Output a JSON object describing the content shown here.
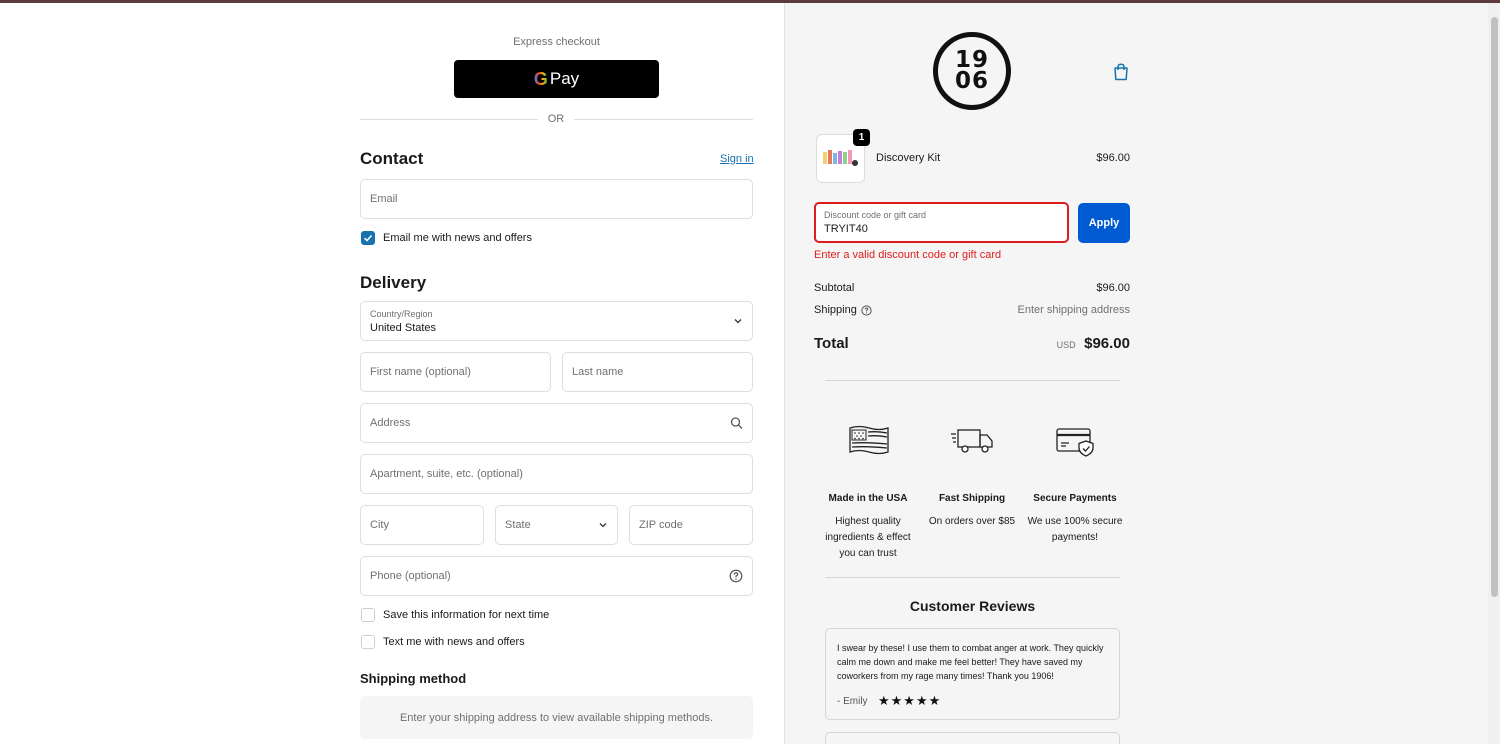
{
  "express": {
    "label": "Express checkout",
    "gpay_label": "Pay",
    "or_label": "OR"
  },
  "contact": {
    "title": "Contact",
    "signin_label": "Sign in",
    "email_placeholder": "Email",
    "news_label": "Email me with news and offers"
  },
  "delivery": {
    "title": "Delivery",
    "country_label": "Country/Region",
    "country_value": "United States",
    "first_name_placeholder": "First name (optional)",
    "last_name_placeholder": "Last name",
    "address_placeholder": "Address",
    "apartment_placeholder": "Apartment, suite, etc. (optional)",
    "city_placeholder": "City",
    "state_placeholder": "State",
    "zip_placeholder": "ZIP code",
    "phone_placeholder": "Phone (optional)",
    "save_info_label": "Save this information for next time",
    "text_me_label": "Text me with news and offers"
  },
  "shipping_method": {
    "title": "Shipping method",
    "notice": "Enter your shipping address to view available shipping methods."
  },
  "brand": {
    "logo_top": "19",
    "logo_bottom": "06"
  },
  "cart": {
    "item_name": "Discovery Kit",
    "item_price": "$96.00",
    "item_qty": "1"
  },
  "discount": {
    "label": "Discount code or gift card",
    "value": "TRYIT40",
    "apply_label": "Apply",
    "error": "Enter a valid discount code or gift card"
  },
  "summary": {
    "subtotal_label": "Subtotal",
    "subtotal_value": "$96.00",
    "shipping_label": "Shipping",
    "shipping_value": "Enter shipping address",
    "total_label": "Total",
    "currency": "USD",
    "total_value": "$96.00"
  },
  "features": [
    {
      "title": "Made in the USA",
      "desc": "Highest quality ingredients & effect you can trust"
    },
    {
      "title": "Fast Shipping",
      "desc": "On orders over $85"
    },
    {
      "title": "Secure Payments",
      "desc": "We use 100% secure payments!"
    }
  ],
  "reviews": {
    "title": "Customer Reviews",
    "items": [
      {
        "text": "I swear by these! I use them to combat anger at work. They quickly calm me down and make me feel better! They have saved my coworkers from my rage many times! Thank you 1906!",
        "author": "- Emily",
        "stars": "★★★★★"
      }
    ]
  },
  "colors": {
    "accent": "#1773b0",
    "apply_button": "#005bd3",
    "error": "#dd1d1d"
  }
}
